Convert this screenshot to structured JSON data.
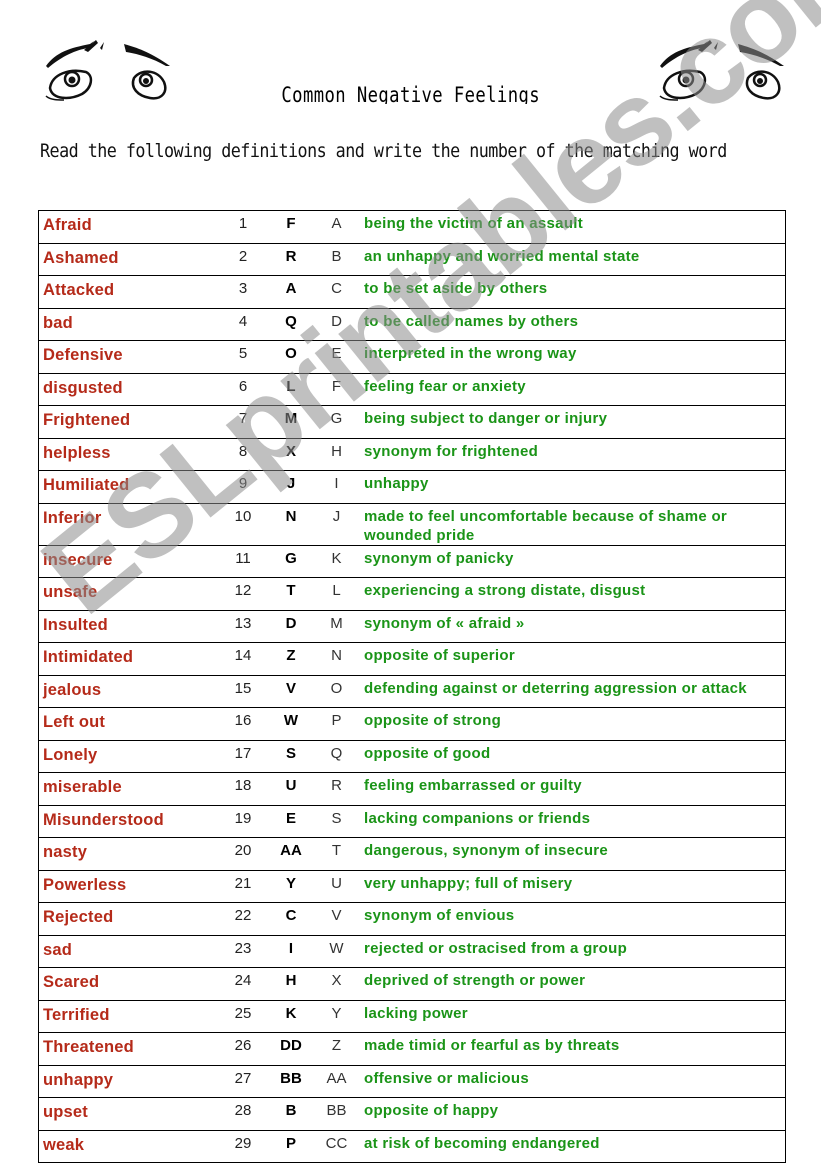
{
  "header": {
    "title": "Common Negative Feelings",
    "instructions": "Read the following definitions and write the number of the matching word",
    "decorations": [
      "worried-eyes-icon",
      "worried-eyes-icon"
    ]
  },
  "colors": {
    "word": "#b52a19",
    "definition": "#1a9417",
    "answer": "#000000",
    "watermark": "#8c8c8c"
  },
  "watermark": "ESLprintables.com",
  "rows": [
    {
      "word": "Afraid",
      "num": "1",
      "answer": "F",
      "letter": "A",
      "definition": "being the victim of an assault"
    },
    {
      "word": "Ashamed",
      "num": "2",
      "answer": "R",
      "letter": "B",
      "definition": "an unhappy and worried mental state"
    },
    {
      "word": "Attacked",
      "num": "3",
      "answer": "A",
      "letter": "C",
      "definition": "to be set aside by others"
    },
    {
      "word": "bad",
      "num": "4",
      "answer": "Q",
      "letter": "D",
      "definition": "to be called names by others"
    },
    {
      "word": "Defensive",
      "num": "5",
      "answer": "O",
      "letter": "E",
      "definition": "interpreted in the wrong way"
    },
    {
      "word": "disgusted",
      "num": "6",
      "answer": "L",
      "letter": "F",
      "definition": "feeling fear or anxiety"
    },
    {
      "word": "Frightened",
      "num": "7",
      "answer": "M",
      "letter": "G",
      "definition": "being subject to danger or injury"
    },
    {
      "word": "helpless",
      "num": "8",
      "answer": "X",
      "letter": "H",
      "definition": "synonym for frightened"
    },
    {
      "word": "Humiliated",
      "num": "9",
      "answer": "J",
      "letter": "I",
      "definition": "unhappy"
    },
    {
      "word": "Inferior",
      "num": "10",
      "answer": "N",
      "letter": "J",
      "definition": "made to feel uncomfortable because of shame or wounded pride"
    },
    {
      "word": "insecure",
      "num": "11",
      "answer": "G",
      "letter": "K",
      "definition": "synonym of panicky"
    },
    {
      "word": "unsafe",
      "num": "12",
      "answer": "T",
      "letter": "L",
      "definition": "experiencing a strong distate, disgust"
    },
    {
      "word": "Insulted",
      "num": "13",
      "answer": "D",
      "letter": "M",
      "definition": "synonym of « afraid »"
    },
    {
      "word": "Intimidated",
      "num": "14",
      "answer": "Z",
      "letter": "N",
      "definition": "opposite of superior"
    },
    {
      "word": "jealous",
      "num": "15",
      "answer": "V",
      "letter": "O",
      "definition": "defending against or deterring aggression or attack"
    },
    {
      "word": "Left out",
      "num": "16",
      "answer": "W",
      "letter": "P",
      "definition": "opposite of strong"
    },
    {
      "word": "Lonely",
      "num": "17",
      "answer": "S",
      "letter": "Q",
      "definition": "opposite of good"
    },
    {
      "word": "miserable",
      "num": "18",
      "answer": "U",
      "letter": "R",
      "definition": "feeling embarrassed or guilty"
    },
    {
      "word": "Misunderstood",
      "num": "19",
      "answer": "E",
      "letter": "S",
      "definition": "lacking companions or friends"
    },
    {
      "word": "nasty",
      "num": "20",
      "answer": "AA",
      "letter": "T",
      "definition": "dangerous, synonym of insecure"
    },
    {
      "word": "Powerless",
      "num": "21",
      "answer": "Y",
      "letter": "U",
      "definition": "very unhappy; full of misery"
    },
    {
      "word": "Rejected",
      "num": "22",
      "answer": "C",
      "letter": "V",
      "definition": "synonym of envious"
    },
    {
      "word": "sad",
      "num": "23",
      "answer": "I",
      "letter": "W",
      "definition": "rejected or ostracised from a group"
    },
    {
      "word": "Scared",
      "num": "24",
      "answer": "H",
      "letter": "X",
      "definition": "deprived of strength or power"
    },
    {
      "word": "Terrified",
      "num": "25",
      "answer": "K",
      "letter": "Y",
      "definition": "lacking power"
    },
    {
      "word": "Threatened",
      "num": "26",
      "answer": "DD",
      "letter": "Z",
      "definition": "made timid or fearful as by threats"
    },
    {
      "word": "unhappy",
      "num": "27",
      "answer": "BB",
      "letter": "AA",
      "definition": "offensive or  malicious"
    },
    {
      "word": "upset",
      "num": "28",
      "answer": "B",
      "letter": "BB",
      "definition": "opposite of happy"
    },
    {
      "word": "weak",
      "num": "29",
      "answer": "P",
      "letter": "CC",
      "definition": "at risk of becoming endangered"
    }
  ]
}
